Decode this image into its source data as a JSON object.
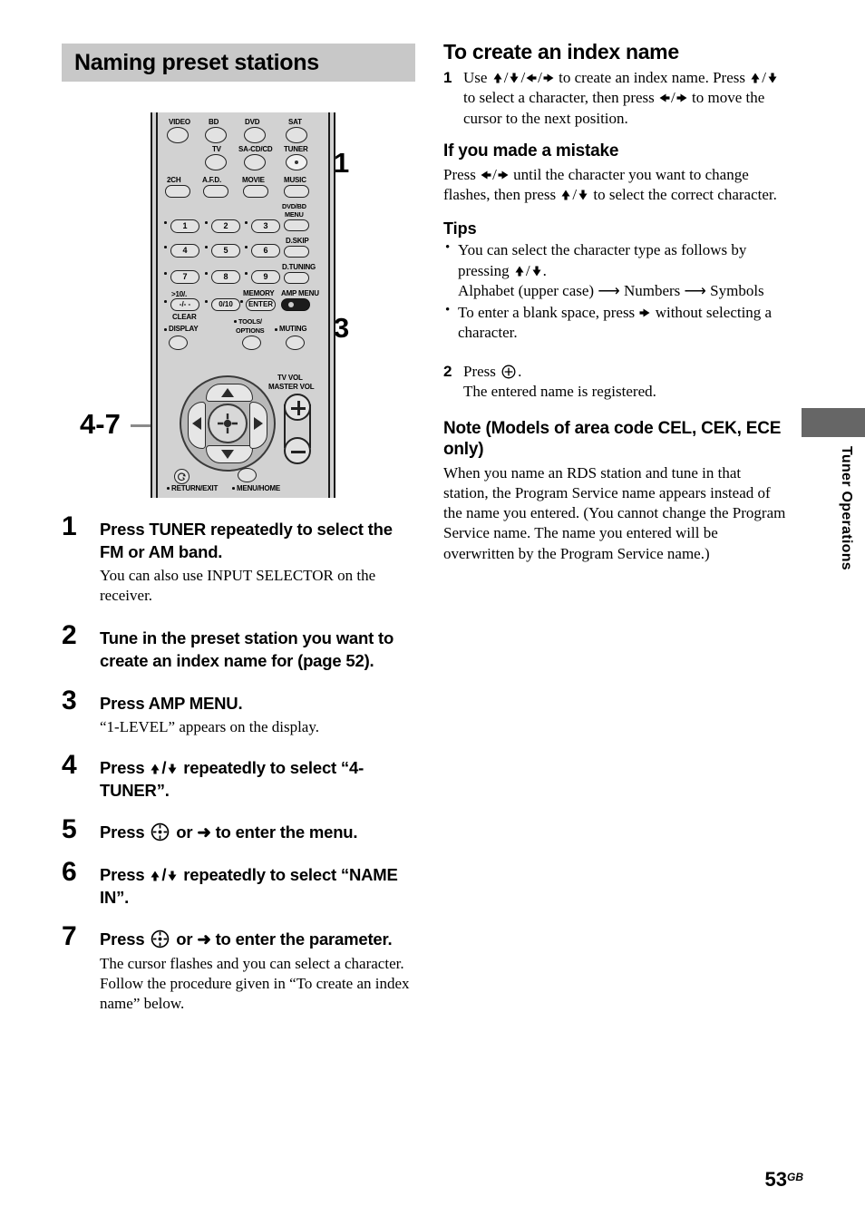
{
  "section": {
    "title": "Naming preset stations"
  },
  "diagram": {
    "name": "remote-control-diagram",
    "callouts": [
      {
        "label": "1",
        "target": "TUNER button"
      },
      {
        "label": "3",
        "target": "AMP MENU button"
      },
      {
        "label": "4-7",
        "target": "cursor pad"
      }
    ],
    "buttons": {
      "row_source_top": [
        "VIDEO",
        "BD",
        "DVD",
        "SAT"
      ],
      "row_source_mid": [
        "TV",
        "SA-CD/CD",
        "TUNER"
      ],
      "row_field": [
        "2CH",
        "A.F.D.",
        "MOVIE",
        "MUSIC"
      ],
      "menu_label_1": "DVD/BD",
      "menu_label_2": "MENU",
      "d_skip": "D.SKIP",
      "d_tuning": "D.TUNING",
      "numbers": [
        "1",
        "2",
        "3",
        "4",
        "5",
        "6",
        "7",
        "8",
        "9"
      ],
      "ten_key_1": ">10/.",
      "ten_key_2": "-/- -",
      "ten_key_3": "CLEAR",
      "zero": "0/10",
      "memory": "MEMORY",
      "enter": "ENTER",
      "amp_menu": "AMP MENU",
      "display": "DISPLAY",
      "tools_1": "TOOLS/",
      "tools_2": "OPTIONS",
      "muting": "MUTING",
      "tv_vol": "TV VOL",
      "master_vol": "MASTER VOL",
      "return_exit": "RETURN/EXIT",
      "menu_home": "MENU/HOME"
    }
  },
  "steps": [
    {
      "num": "1",
      "head": "Press TUNER repeatedly to select the FM or AM band.",
      "body": "You can also use INPUT SELECTOR on the receiver."
    },
    {
      "num": "2",
      "head": "Tune in the preset station you want to create an index name for (page 52).",
      "body": ""
    },
    {
      "num": "3",
      "head": "Press AMP MENU.",
      "body": "“1-LEVEL” appears on the display."
    },
    {
      "num": "4",
      "head": "Press ♦/♦ repeatedly to select “4-TUNER”.",
      "head_pre": "Press ",
      "head_post": " repeatedly to select “4-TUNER”.",
      "body": ""
    },
    {
      "num": "5",
      "head_pre": "Press ",
      "head_post": " or ➜ to enter the menu.",
      "body": ""
    },
    {
      "num": "6",
      "head_pre": "Press ",
      "head_post": " repeatedly to select “NAME IN”.",
      "body": ""
    },
    {
      "num": "7",
      "head_pre": "Press ",
      "head_post": " or ➜ to enter the parameter.",
      "body": "The cursor flashes and you can select a character. Follow the procedure given in “To create an index name” below."
    }
  ],
  "right": {
    "heading": "To create an index name",
    "step1": {
      "num": "1",
      "line1_pre": "Use ",
      "line1_arrows": "⮝/⮟/⮜/⮞",
      "line1_post": " to create an index name.",
      "line2_pre": "Press ",
      "line2_post": " to select a character, then press",
      "line3_post": " to move the cursor to the next position."
    },
    "mistake": {
      "heading": "If you made a mistake",
      "text_pre": "Press ",
      "text_mid": " until the character you want to change flashes, then press ",
      "text_post": " to select the correct character."
    },
    "tips": {
      "heading": "Tips",
      "items": [
        {
          "text_pre": "You can select the character type as follows by pressing ",
          "text_post": ".",
          "sub": "Alphabet (upper case) ⟶ Numbers ⟶ Symbols"
        },
        {
          "text_pre": "To enter a blank space, press ",
          "text_post": " without selecting a character."
        }
      ]
    },
    "step2": {
      "num": "2",
      "line1_pre": "Press ",
      "line1_post": ".",
      "line2": "The entered name is registered."
    },
    "note": {
      "heading": "Note (Models of area code CEL, CEK, ECE only)",
      "text": "When you name an RDS station and tune in that station, the Program Service name appears instead of the name you entered. (You cannot change the Program Service name. The name you entered will be overwritten by the Program Service name.)"
    }
  },
  "side_tab": {
    "label": "Tuner Operations",
    "color": "#666666"
  },
  "footer": {
    "page": "53",
    "suffix": "GB"
  },
  "glyphs": {
    "arrow_up": "⮝",
    "arrow_down": "⮟",
    "arrow_left": "⮜",
    "arrow_right": "⮞",
    "arrow_right_bold": "⮞",
    "slash": "/"
  }
}
